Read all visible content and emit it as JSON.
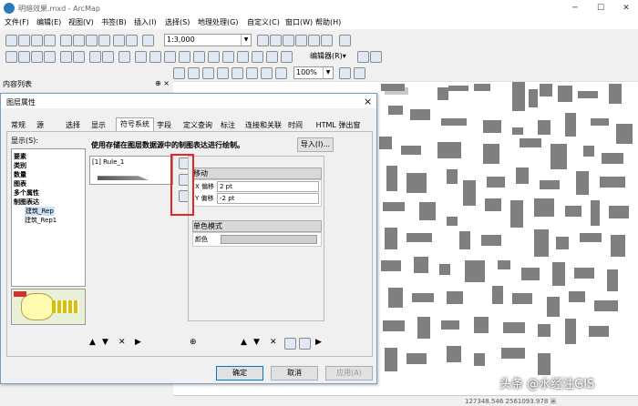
{
  "window": {
    "title": "明暗效果.mxd - ArcMap"
  },
  "menu": [
    "文件(F)",
    "编辑(E)",
    "视图(V)",
    "书签(B)",
    "插入(I)",
    "选择(S)",
    "地理处理(G)",
    "自定义(C)",
    "窗口(W)",
    "帮助(H)"
  ],
  "toolbar": {
    "scale": "1:3,000",
    "zoom": "100%",
    "editor_label": "编辑器(R)▾"
  },
  "toc": {
    "title": "内容列表",
    "pin": "⊕ ×"
  },
  "dialog": {
    "title": "图层属性",
    "close": "×",
    "tabs": [
      "常规",
      "源",
      "选择",
      "显示",
      "符号系统",
      "字段",
      "定义查询",
      "标注",
      "连接和关联",
      "时间",
      "HTML 弹出窗口"
    ],
    "active_tab": "符号系统",
    "show_label": "显示(S):",
    "tree_items": [
      "要素",
      "类别",
      "数量",
      "图表",
      "多个属性",
      "制图表达",
      "建筑_Rep",
      "建筑_Rep1"
    ],
    "description": "使用存储在图层数据源中的制图表达进行绘制。",
    "import_button": "导入(I)...",
    "rule_name": "[1] Rule_1",
    "move_section": "移动",
    "x_offset_label": "X 偏移",
    "x_offset_value": "2 pt",
    "y_offset_label": "Y 偏移",
    "y_offset_value": "-2 pt",
    "fill_section": "单色模式",
    "color_label": "颜色",
    "ok_button": "确定",
    "cancel_button": "取消",
    "apply_button": "应用(A)"
  },
  "watermark": "头条 @水经注GIS",
  "status": "127348.546  2561093.978 米"
}
